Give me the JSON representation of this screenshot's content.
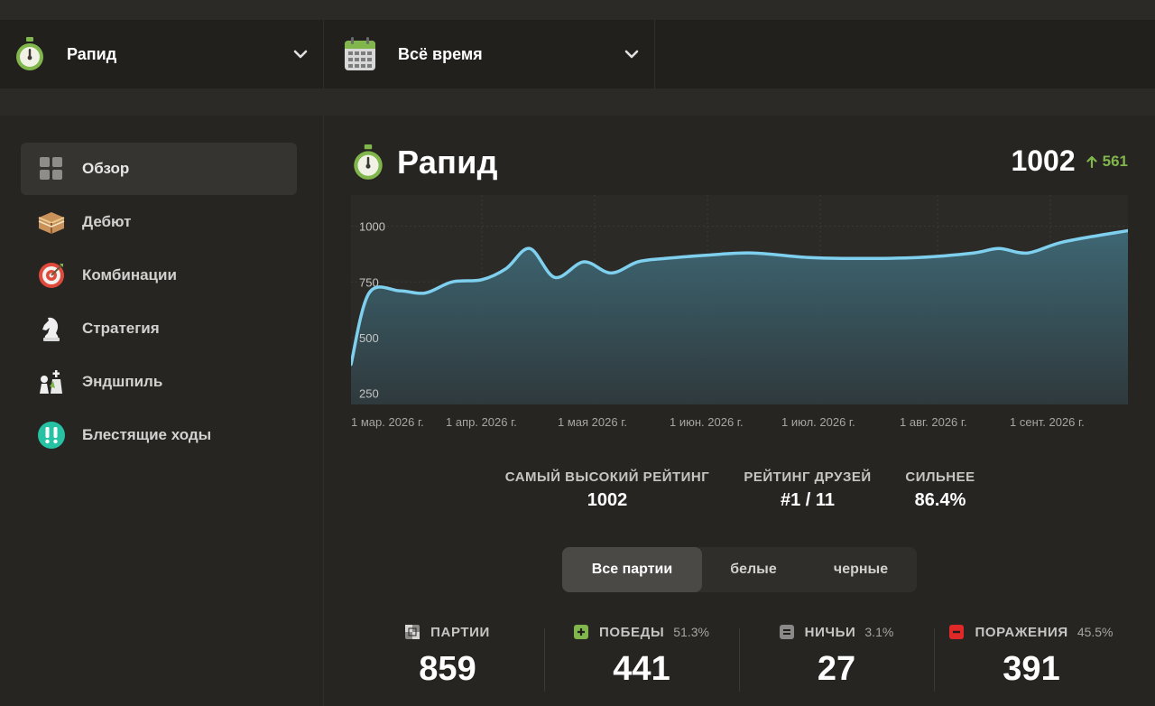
{
  "filters": {
    "game_type": {
      "label": "Рапид",
      "icon": "stopwatch-icon"
    },
    "period": {
      "label": "Всё время",
      "icon": "calendar-icon"
    }
  },
  "sidebar": {
    "items": [
      {
        "label": "Обзор",
        "icon": "grid-icon",
        "active": true
      },
      {
        "label": "Дебют",
        "icon": "book-icon"
      },
      {
        "label": "Комбинации",
        "icon": "target-icon"
      },
      {
        "label": "Стратегия",
        "icon": "knight-icon"
      },
      {
        "label": "Эндшпиль",
        "icon": "king-pawn-icon"
      },
      {
        "label": "Блестящие ходы",
        "icon": "brilliant-icon"
      }
    ]
  },
  "header": {
    "title": "Рапид",
    "rating": "1002",
    "delta": "561"
  },
  "chart_data": {
    "type": "area",
    "x": [
      "1 мар.",
      "6 мар.",
      "15 мар.",
      "22 мар.",
      "1 апр.",
      "8 апр.",
      "14 апр.",
      "20 апр.",
      "26 апр.",
      "1 мая",
      "7 мая",
      "13 мая",
      "20 мая",
      "1 июн.",
      "15 июн.",
      "1 июл.",
      "15 июл.",
      "1 авг.",
      "15 авг.",
      "22 авг.",
      "1 сент.",
      "8 сент.",
      "15 сент."
    ],
    "values": [
      380,
      700,
      710,
      700,
      750,
      760,
      810,
      900,
      770,
      840,
      790,
      840,
      855,
      870,
      880,
      860,
      855,
      860,
      880,
      900,
      880,
      930,
      980
    ],
    "ylim": [
      200,
      1140
    ],
    "yticks": [
      "1000",
      "750",
      "500",
      "250"
    ],
    "xtick_labels": [
      "1 мар. 2026 г.",
      "1 апр. 2026 г.",
      "1 мая 2026 г.",
      "1 июн. 2026 г.",
      "1 июл. 2026 г.",
      "1 авг. 2026 г.",
      "1 сент. 2026 г."
    ],
    "line_color": "#7fd0ef",
    "grid": true
  },
  "stats": {
    "highest_label": "САМЫЙ ВЫСОКИЙ РЕЙТИНГ",
    "highest_value": "1002",
    "friends_label": "РЕЙТИНГ ДРУЗЕЙ",
    "friends_value": "#1 / 11",
    "better_label": "СИЛЬНЕЕ",
    "better_value": "86.4%"
  },
  "segment": {
    "options": [
      "Все партии",
      "белые",
      "черные"
    ],
    "active": 0
  },
  "counts": {
    "games": {
      "label": "ПАРТИИ",
      "value": "859"
    },
    "wins": {
      "label": "ПОБЕДЫ",
      "pct": "51.3%",
      "value": "441",
      "color": "#81b64c"
    },
    "draws": {
      "label": "НИЧЬИ",
      "pct": "3.1%",
      "value": "27",
      "color": "#8b8987"
    },
    "losses": {
      "label": "ПОРАЖЕНИЯ",
      "pct": "45.5%",
      "value": "391",
      "color": "#e02828"
    }
  }
}
